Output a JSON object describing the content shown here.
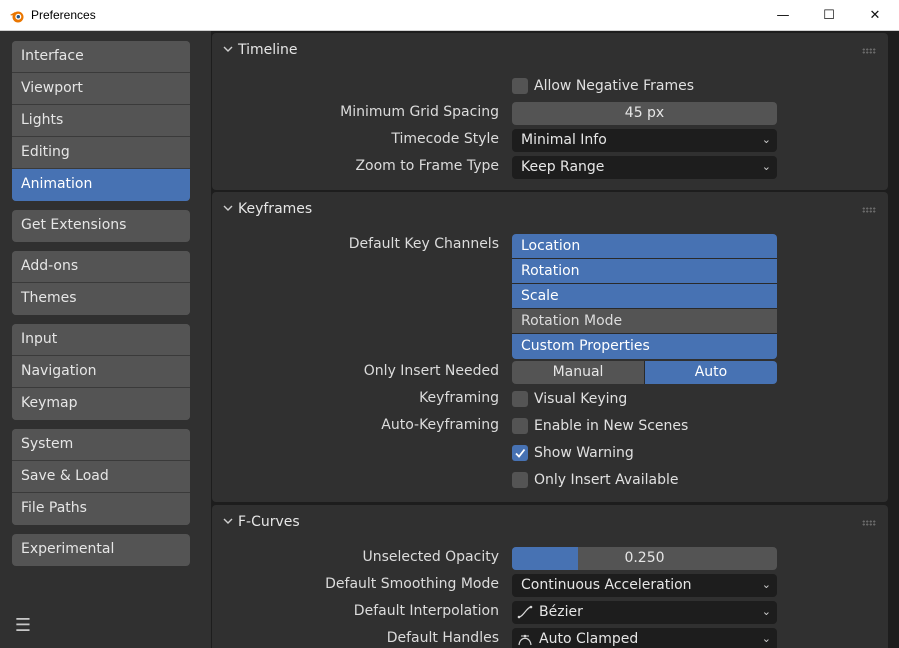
{
  "window": {
    "title": "Preferences",
    "minimize": "—",
    "maximize": "☐",
    "close": "✕"
  },
  "sidebar": {
    "groups": [
      [
        "Interface",
        "Viewport",
        "Lights",
        "Editing",
        "Animation"
      ],
      [
        "Get Extensions"
      ],
      [
        "Add-ons",
        "Themes"
      ],
      [
        "Input",
        "Navigation",
        "Keymap"
      ],
      [
        "System",
        "Save & Load",
        "File Paths"
      ],
      [
        "Experimental"
      ]
    ],
    "active": "Animation",
    "menu_icon": "hamburger-icon"
  },
  "timeline": {
    "title": "Timeline",
    "allow_negative_frames": {
      "label": "Allow Negative Frames",
      "checked": false
    },
    "min_grid_spacing": {
      "label": "Minimum Grid Spacing",
      "value": "45 px"
    },
    "timecode_style": {
      "label": "Timecode Style",
      "value": "Minimal Info"
    },
    "zoom_to_frame_type": {
      "label": "Zoom to Frame Type",
      "value": "Keep Range"
    }
  },
  "keyframes": {
    "title": "Keyframes",
    "default_key_channels": {
      "label": "Default Key Channels",
      "channels": [
        {
          "name": "Location",
          "on": true
        },
        {
          "name": "Rotation",
          "on": true
        },
        {
          "name": "Scale",
          "on": true
        },
        {
          "name": "Rotation Mode",
          "on": false
        },
        {
          "name": "Custom Properties",
          "on": true
        }
      ]
    },
    "only_insert_needed": {
      "label": "Only Insert Needed",
      "options": [
        "Manual",
        "Auto"
      ],
      "selected": "Auto"
    },
    "keyframing": {
      "label": "Keyframing",
      "visual_keying": {
        "label": "Visual Keying",
        "checked": false
      }
    },
    "auto_keyframing": {
      "label": "Auto-Keyframing",
      "enable_in_new_scenes": {
        "label": "Enable in New Scenes",
        "checked": false
      },
      "show_warning": {
        "label": "Show Warning",
        "checked": true
      },
      "only_insert_available": {
        "label": "Only Insert Available",
        "checked": false
      }
    }
  },
  "fcurves": {
    "title": "F-Curves",
    "unselected_opacity": {
      "label": "Unselected Opacity",
      "value": "0.250",
      "fraction": 0.25
    },
    "default_smoothing_mode": {
      "label": "Default Smoothing Mode",
      "value": "Continuous Acceleration"
    },
    "default_interpolation": {
      "label": "Default Interpolation",
      "value": "Bézier"
    },
    "default_handles": {
      "label": "Default Handles",
      "value": "Auto Clamped"
    }
  },
  "colors": {
    "accent": "#4772b3",
    "panel": "#303030",
    "field": "#545454",
    "dark": "#1d1d1d"
  }
}
